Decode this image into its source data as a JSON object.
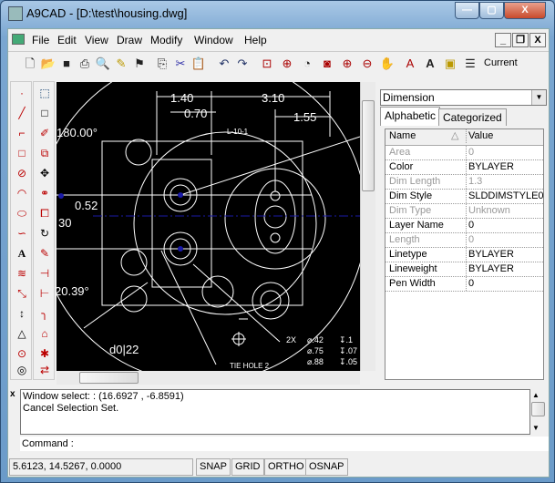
{
  "window": {
    "title": "A9CAD - [D:\\test\\housing.dwg]",
    "minimize": "—",
    "maximize": "▢",
    "close": "X"
  },
  "menu": {
    "items": [
      "File",
      "Edit",
      "View",
      "Draw",
      "Modify",
      "Window",
      "Help"
    ],
    "mdi_minimize": "_",
    "mdi_restore": "❐",
    "mdi_close": "X"
  },
  "toolbar": {
    "icons": [
      "new-icon",
      "open-icon",
      "save-icon",
      "print-icon",
      "print-preview-icon",
      "pencil-icon",
      "properties-icon",
      "copy-icon",
      "cut-icon",
      "paste-icon",
      "undo-icon",
      "redo-icon",
      "zoom-window-icon",
      "zoom-center-icon",
      "zoom-previous-icon",
      "zoom-page-icon",
      "zoom-in-icon",
      "zoom-out-icon",
      "pan-icon",
      "dimension-text-icon",
      "text-style-icon",
      "layers-icon",
      "layer-stack-icon"
    ],
    "current_label": "Current"
  },
  "drawing": {
    "labels": [
      "1.40",
      "0.70",
      "3.10",
      "1.55",
      "180.00°",
      "0.52",
      "30",
      "20.39°",
      "d0|22",
      "L-10-1",
      "TIE HOLE 2",
      "2X",
      "⌀.42",
      "⌀.75",
      "⌀.88",
      "↧.1",
      "↧.07",
      "↧.05"
    ]
  },
  "properties": {
    "selected": "Dimension",
    "tabs": [
      "Alphabetic",
      "Categorized"
    ],
    "header": {
      "name": "Name",
      "value": "Value"
    },
    "rows": [
      {
        "name": "Area",
        "value": "0",
        "enabled": false
      },
      {
        "name": "Color",
        "value": "BYLAYER",
        "enabled": true
      },
      {
        "name": "Dim Length",
        "value": "1.3",
        "enabled": false
      },
      {
        "name": "Dim Style",
        "value": "SLDDIMSTYLE0",
        "enabled": true
      },
      {
        "name": "Dim Type",
        "value": "Unknown",
        "enabled": false
      },
      {
        "name": "Layer Name",
        "value": "0",
        "enabled": true
      },
      {
        "name": "Length",
        "value": "0",
        "enabled": false
      },
      {
        "name": "Linetype",
        "value": "BYLAYER",
        "enabled": true
      },
      {
        "name": "Lineweight",
        "value": "BYLAYER",
        "enabled": true
      },
      {
        "name": "Pen Width",
        "value": "0",
        "enabled": true
      }
    ]
  },
  "command": {
    "history": [
      "Window  select: : (16.6927 , -6.8591)",
      "Cancel Selection Set."
    ],
    "prompt": "Command :"
  },
  "status": {
    "coords": "5.6123, 14.5267, 0.0000",
    "buttons": [
      "SNAP",
      "GRID",
      "ORTHO",
      "OSNAP"
    ]
  }
}
